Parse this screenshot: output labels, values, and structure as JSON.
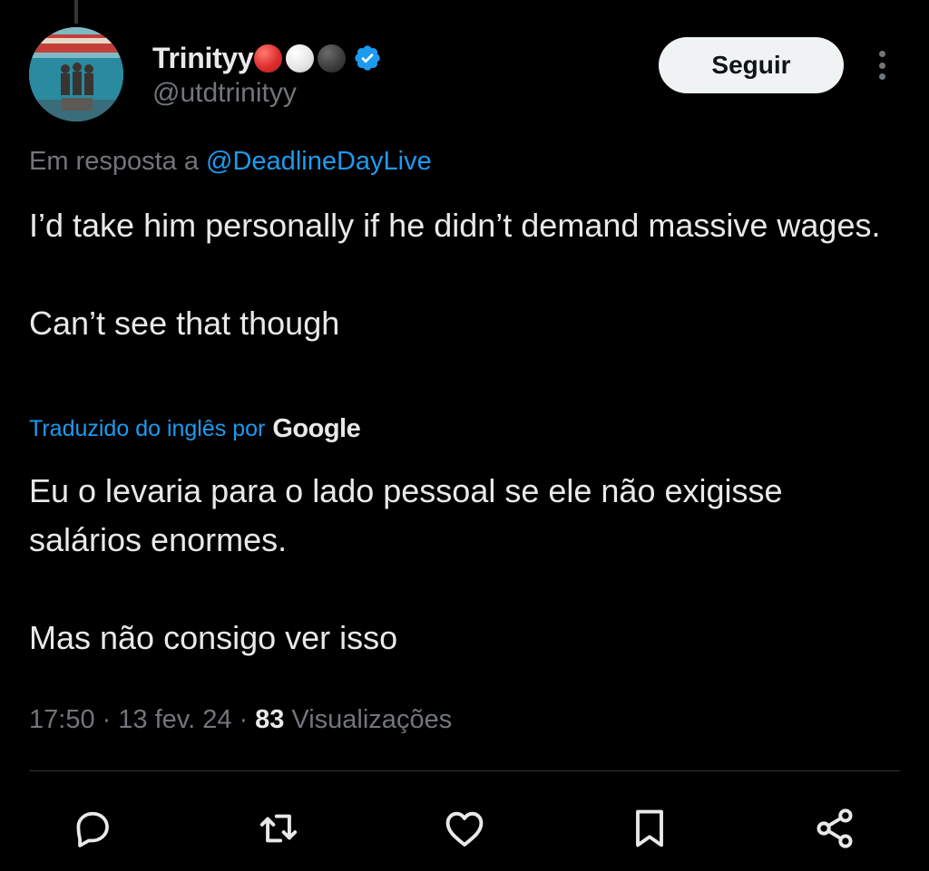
{
  "author": {
    "display_name": "Trinityy",
    "emoji_dots": [
      "red-circle",
      "white-circle",
      "black-circle"
    ],
    "verified_icon": "verified-badge-icon",
    "handle": "@utdtrinityy",
    "avatar": "statue-photo-avatar"
  },
  "header": {
    "follow_label": "Seguir",
    "more_icon": "more-vertical-icon"
  },
  "reply": {
    "prefix": "Em resposta a",
    "mention": "@DeadlineDayLive"
  },
  "tweet": {
    "text": "I’d take him personally if he didn’t demand massive wages.\n\nCan’t see that though"
  },
  "translation": {
    "label": "Traduzido do inglês por",
    "provider": "Google",
    "text": "Eu o levaria para o lado pessoal se ele não exigisse salários enormes.\n\nMas não consigo ver isso"
  },
  "meta": {
    "time": "17:50",
    "date": "13 fev. 24",
    "separator": "·",
    "views_count": "83",
    "views_label": "Visualizações"
  },
  "actions": [
    {
      "name": "reply",
      "icon": "reply-icon"
    },
    {
      "name": "retweet",
      "icon": "retweet-icon"
    },
    {
      "name": "like",
      "icon": "heart-icon"
    },
    {
      "name": "bookmark",
      "icon": "bookmark-icon"
    },
    {
      "name": "share",
      "icon": "share-icon"
    }
  ],
  "colors": {
    "background": "#000000",
    "text_primary": "#e7e9ea",
    "text_secondary": "#71767b",
    "accent": "#1d9bf0",
    "divider": "#2f3336",
    "button_bg": "#eff3f4"
  }
}
